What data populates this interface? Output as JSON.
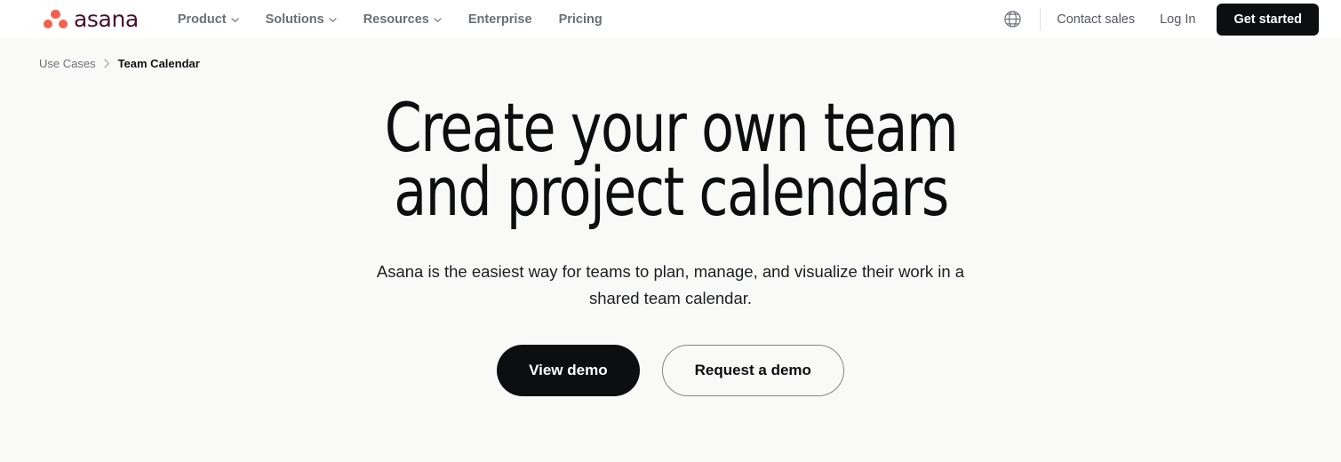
{
  "header": {
    "logo": {
      "name": "asana",
      "wordmark": "asana",
      "dot_color": "#f4604c",
      "word_color": "#4a0d2c"
    },
    "nav": [
      {
        "label": "Product",
        "has_dropdown": true
      },
      {
        "label": "Solutions",
        "has_dropdown": true
      },
      {
        "label": "Resources",
        "has_dropdown": true
      },
      {
        "label": "Enterprise",
        "has_dropdown": false
      },
      {
        "label": "Pricing",
        "has_dropdown": false
      }
    ],
    "language_icon": "globe-icon",
    "contact_sales": "Contact sales",
    "log_in": "Log In",
    "get_started": "Get started",
    "get_started_bg": "#0d0e10"
  },
  "breadcrumb": {
    "parent": "Use Cases",
    "separator": "›",
    "current": "Team Calendar"
  },
  "hero": {
    "heading_line1": "Create your own team",
    "heading_line2": "and project calendars",
    "subtitle": "Asana is the easiest way for teams to plan, manage, and visualize their work in a shared team calendar.",
    "primary_cta": "View demo",
    "secondary_cta": "Request a demo"
  }
}
